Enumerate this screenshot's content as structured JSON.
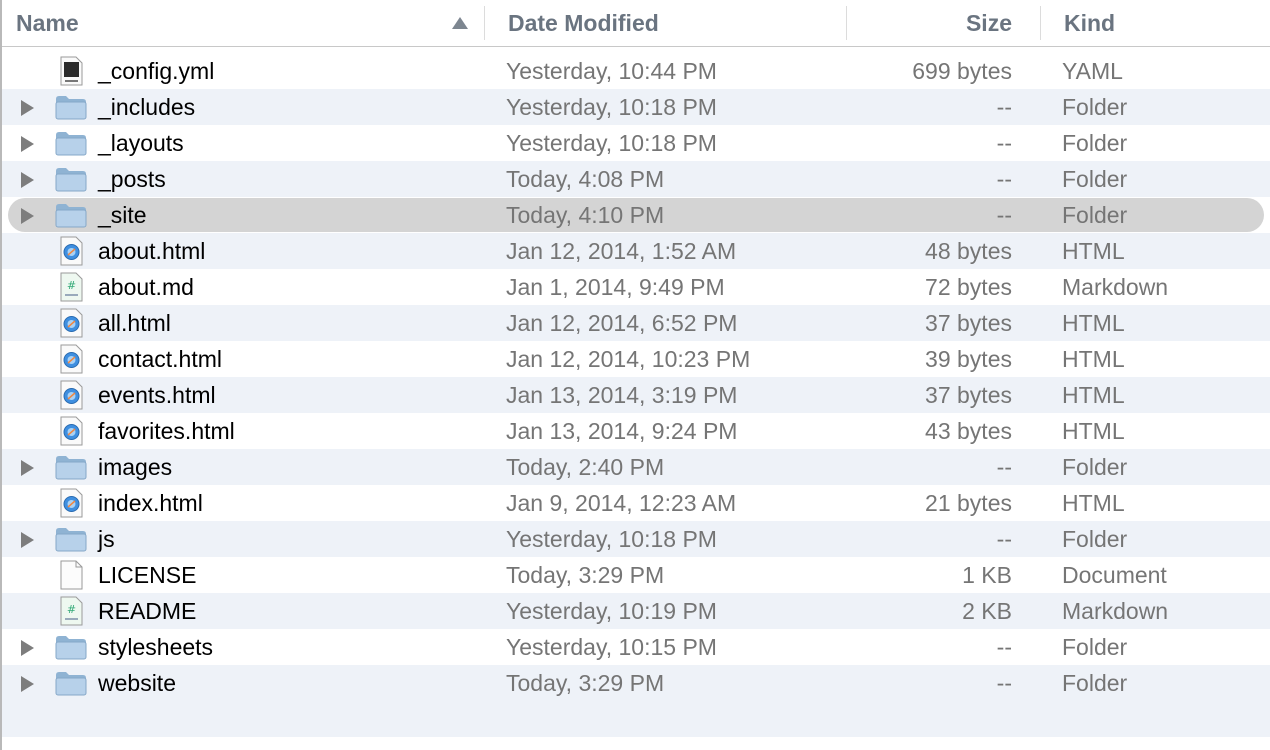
{
  "columns": {
    "name": "Name",
    "date": "Date Modified",
    "size": "Size",
    "kind": "Kind"
  },
  "rows": [
    {
      "name": "_config.yml",
      "date": "Yesterday, 10:44 PM",
      "size": "699 bytes",
      "kind": "YAML",
      "icon": "yaml-file-icon",
      "folder": false
    },
    {
      "name": "_includes",
      "date": "Yesterday, 10:18 PM",
      "size": "--",
      "kind": "Folder",
      "icon": "folder-icon",
      "folder": true
    },
    {
      "name": "_layouts",
      "date": "Yesterday, 10:18 PM",
      "size": "--",
      "kind": "Folder",
      "icon": "folder-icon",
      "folder": true
    },
    {
      "name": "_posts",
      "date": "Today, 4:08 PM",
      "size": "--",
      "kind": "Folder",
      "icon": "folder-icon",
      "folder": true
    },
    {
      "name": "_site",
      "date": "Today, 4:10 PM",
      "size": "--",
      "kind": "Folder",
      "icon": "folder-icon",
      "folder": true,
      "selected": true
    },
    {
      "name": "about.html",
      "date": "Jan 12, 2014, 1:52 AM",
      "size": "48 bytes",
      "kind": "HTML",
      "icon": "html-file-icon",
      "folder": false
    },
    {
      "name": "about.md",
      "date": "Jan 1, 2014, 9:49 PM",
      "size": "72 bytes",
      "kind": "Markdown",
      "icon": "markdown-file-icon",
      "folder": false
    },
    {
      "name": "all.html",
      "date": "Jan 12, 2014, 6:52 PM",
      "size": "37 bytes",
      "kind": "HTML",
      "icon": "html-file-icon",
      "folder": false
    },
    {
      "name": "contact.html",
      "date": "Jan 12, 2014, 10:23 PM",
      "size": "39 bytes",
      "kind": "HTML",
      "icon": "html-file-icon",
      "folder": false
    },
    {
      "name": "events.html",
      "date": "Jan 13, 2014, 3:19 PM",
      "size": "37 bytes",
      "kind": "HTML",
      "icon": "html-file-icon",
      "folder": false
    },
    {
      "name": "favorites.html",
      "date": "Jan 13, 2014, 9:24 PM",
      "size": "43 bytes",
      "kind": "HTML",
      "icon": "html-file-icon",
      "folder": false
    },
    {
      "name": "images",
      "date": "Today, 2:40 PM",
      "size": "--",
      "kind": "Folder",
      "icon": "folder-icon",
      "folder": true
    },
    {
      "name": "index.html",
      "date": "Jan 9, 2014, 12:23 AM",
      "size": "21 bytes",
      "kind": "HTML",
      "icon": "html-file-icon",
      "folder": false
    },
    {
      "name": "js",
      "date": "Yesterday, 10:18 PM",
      "size": "--",
      "kind": "Folder",
      "icon": "folder-icon",
      "folder": true
    },
    {
      "name": "LICENSE",
      "date": "Today, 3:29 PM",
      "size": "1 KB",
      "kind": "Document",
      "icon": "document-file-icon",
      "folder": false
    },
    {
      "name": "README",
      "date": "Yesterday, 10:19 PM",
      "size": "2 KB",
      "kind": "Markdown",
      "icon": "markdown-file-icon",
      "folder": false
    },
    {
      "name": "stylesheets",
      "date": "Yesterday, 10:15 PM",
      "size": "--",
      "kind": "Folder",
      "icon": "folder-icon",
      "folder": true
    },
    {
      "name": "website",
      "date": "Today, 3:29 PM",
      "size": "--",
      "kind": "Folder",
      "icon": "folder-icon",
      "folder": true
    }
  ],
  "colors": {
    "header_text": "#6a7480",
    "alt_row": "#eef2f8",
    "selection": "#d4d4d4",
    "secondary_text": "#757575"
  }
}
